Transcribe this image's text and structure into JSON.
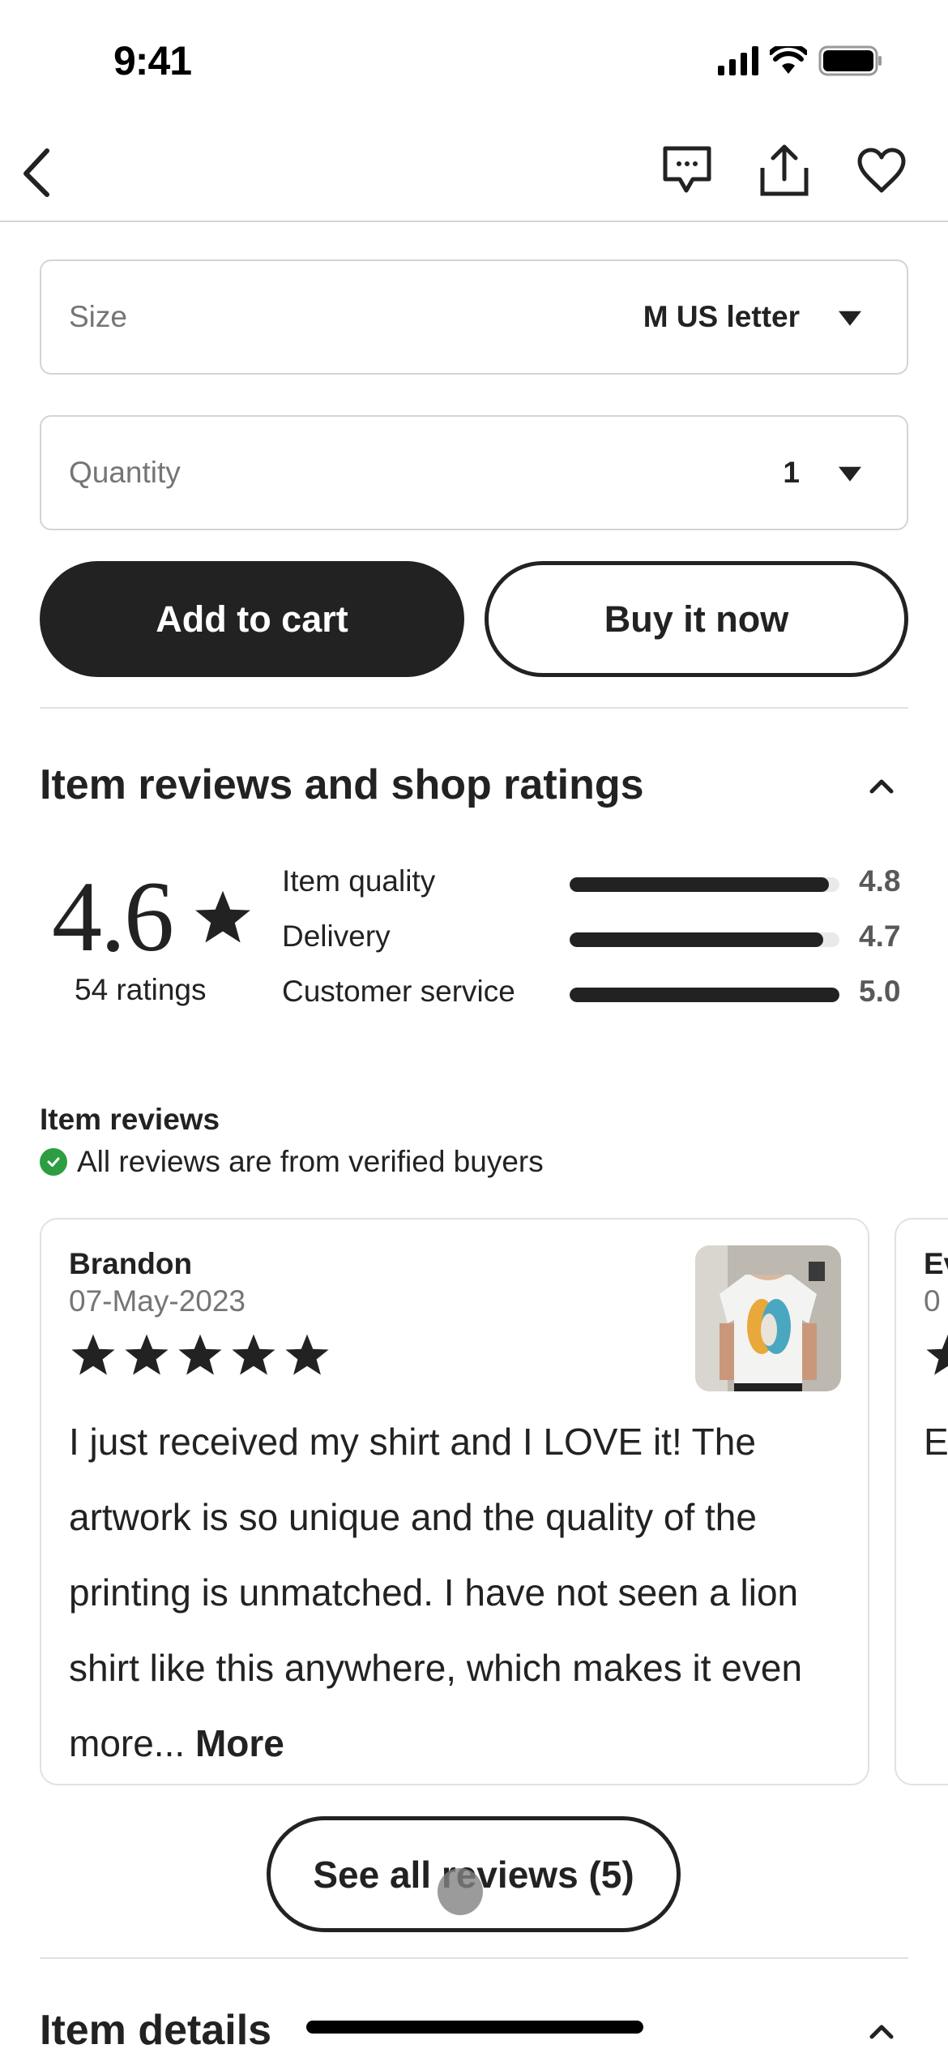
{
  "status_bar": {
    "time": "9:41",
    "icons": [
      "cellular-signal-icon",
      "wifi-icon",
      "battery-icon"
    ]
  },
  "nav": {
    "back_icon": "chevron-left-icon",
    "actions": [
      "message-icon",
      "share-icon",
      "heart-icon"
    ]
  },
  "options": {
    "size": {
      "label": "Size",
      "value": "M US letter"
    },
    "quantity": {
      "label": "Quantity",
      "value": "1"
    }
  },
  "buttons": {
    "add_to_cart": "Add to cart",
    "buy_now": "Buy it now"
  },
  "reviews_section": {
    "title": "Item reviews and shop ratings",
    "overall_rating": "4.6",
    "ratings_count": "54 ratings",
    "metrics": [
      {
        "label": "Item quality",
        "value": "4.8",
        "score": 4.8,
        "max": 5
      },
      {
        "label": "Delivery",
        "value": "4.7",
        "score": 4.7,
        "max": 5
      },
      {
        "label": "Customer service",
        "value": "5.0",
        "score": 5.0,
        "max": 5
      }
    ],
    "item_reviews_heading": "Item reviews",
    "verified_text": "All reviews are from verified buyers",
    "verified_color": "#2c9e41",
    "reviews": [
      {
        "name": "Brandon",
        "date": "07-May-2023",
        "stars": 5,
        "text": "I just received my shirt and I LOVE it! The artwork is so unique and the quality of the printing is unmatched. I have not seen a lion shirt like this anywhere, which makes it even more...",
        "more_label": "More"
      },
      {
        "name": "Ev",
        "date": "0",
        "stars": 1,
        "text": "E"
      }
    ],
    "see_all_label": "See all reviews (5)"
  },
  "item_details": {
    "title": "Item details"
  }
}
